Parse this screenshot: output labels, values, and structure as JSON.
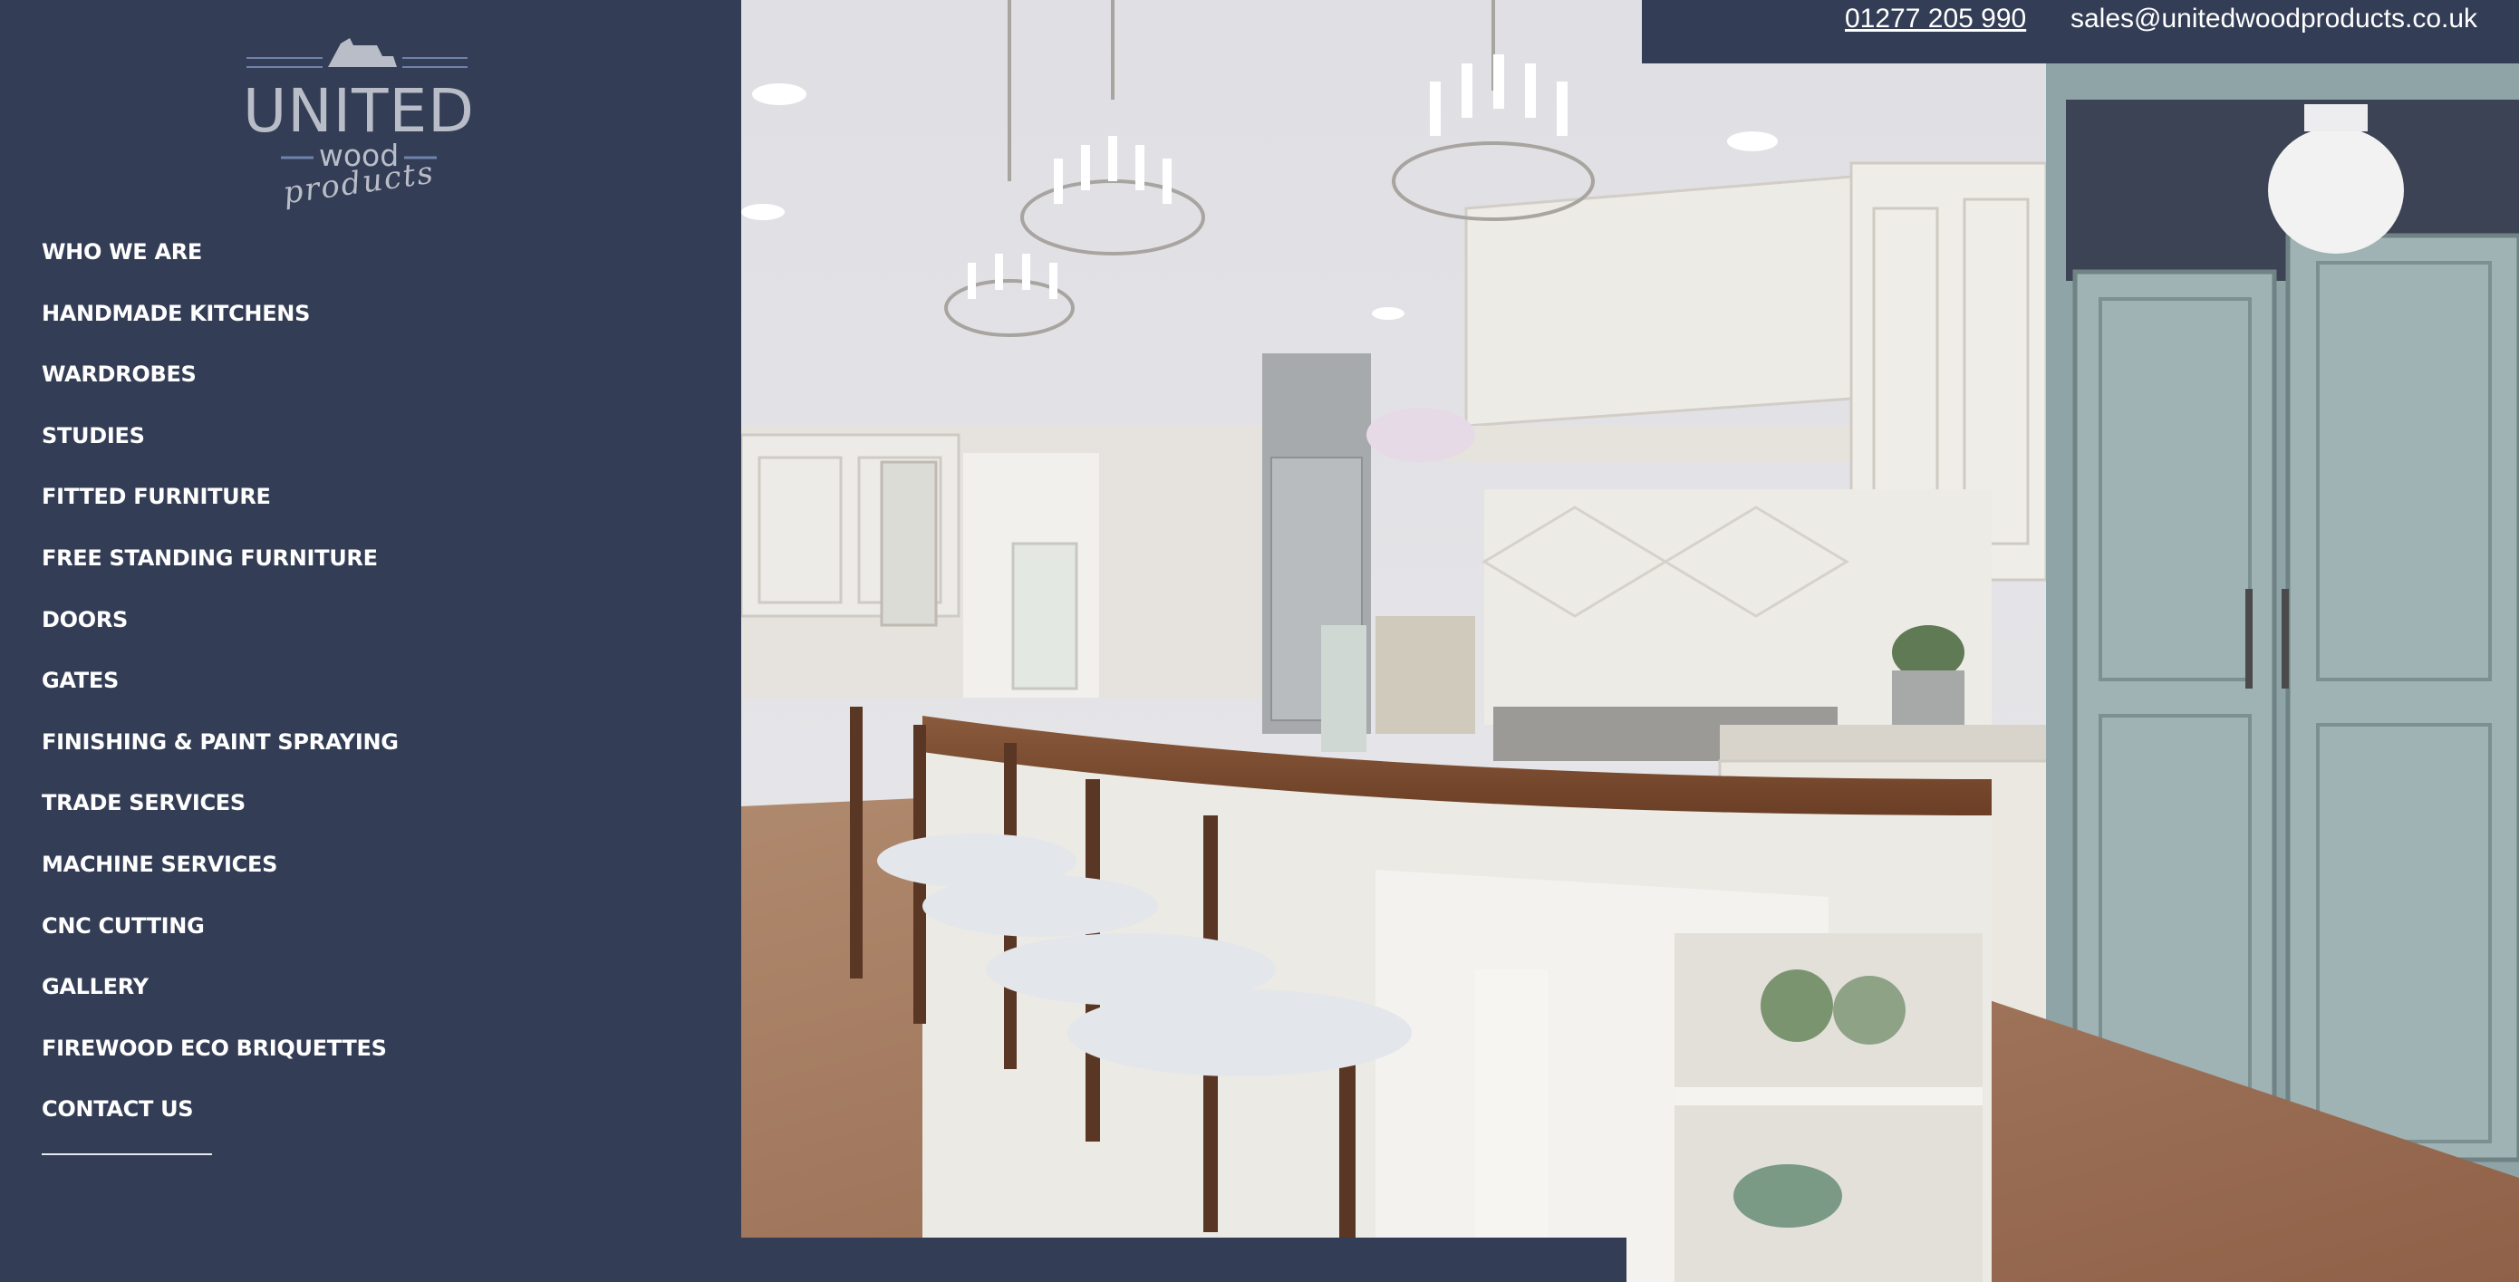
{
  "brand": {
    "logo_line1": "UNITED",
    "logo_line2": "wood",
    "logo_line3": "products"
  },
  "contact": {
    "phone": "01277 205 990",
    "email": "sales@unitedwoodproducts.co.uk"
  },
  "nav": {
    "items": [
      {
        "label": "WHO WE ARE"
      },
      {
        "label": "HANDMADE KITCHENS"
      },
      {
        "label": "WARDROBES"
      },
      {
        "label": "STUDIES"
      },
      {
        "label": "FITTED FURNITURE"
      },
      {
        "label": "FREE STANDING FURNITURE"
      },
      {
        "label": "DOORS"
      },
      {
        "label": "GATES"
      },
      {
        "label": "FINISHING & PAINT SPRAYING"
      },
      {
        "label": "TRADE SERVICES"
      },
      {
        "label": "MACHINE SERVICES"
      },
      {
        "label": "CNC CUTTING"
      },
      {
        "label": "GALLERY"
      },
      {
        "label": "FIREWOOD ECO BRIQUETTES"
      },
      {
        "label": "CONTACT US"
      }
    ]
  },
  "colors": {
    "navy": "#333d55",
    "text": "#ffffff",
    "logo": "#b9bdc8",
    "cabinet_green": "#8fa4a6",
    "countertop": "#7a4a2e"
  }
}
